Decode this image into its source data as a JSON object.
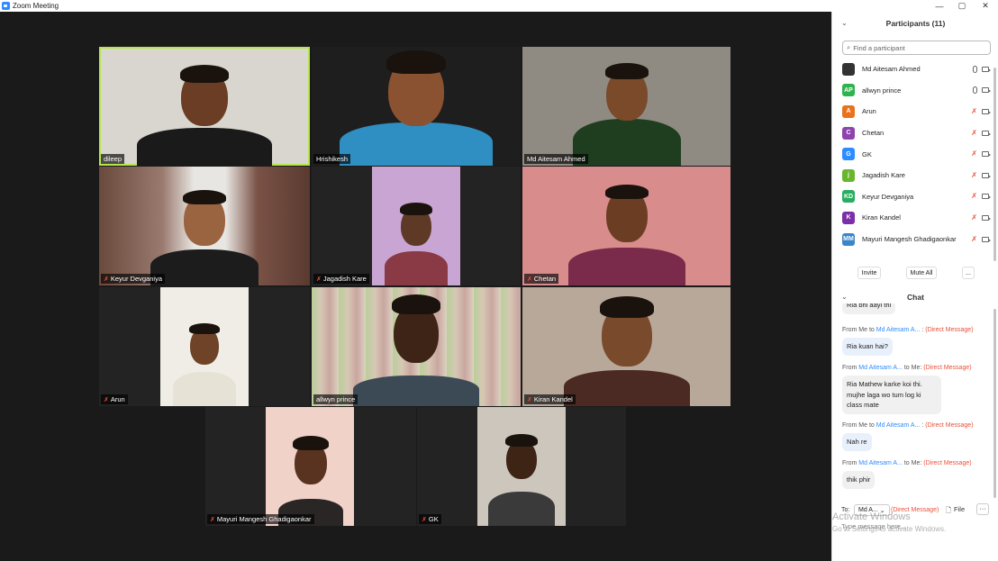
{
  "window": {
    "title": "Zoom Meeting",
    "controls": [
      "—",
      "▢",
      "✕"
    ]
  },
  "tiles": [
    {
      "name": "dileep",
      "muted": false,
      "active": true
    },
    {
      "name": "Hrishikesh",
      "muted": false,
      "active": false
    },
    {
      "name": "Md Aitesam Ahmed",
      "muted": false,
      "active": false
    },
    {
      "name": "Keyur Devganiya",
      "muted": true,
      "active": false
    },
    {
      "name": "Jagadish Kare",
      "muted": true,
      "active": false
    },
    {
      "name": "Chetan",
      "muted": true,
      "active": false
    },
    {
      "name": "Arun",
      "muted": true,
      "active": false
    },
    {
      "name": "allwyn prince",
      "muted": false,
      "active": false
    },
    {
      "name": "Kiran Kandel",
      "muted": true,
      "active": false
    },
    {
      "name": "Mayuri Mangesh Ghadigaonkar",
      "muted": true,
      "active": false
    },
    {
      "name": "GK",
      "muted": true,
      "active": false
    }
  ],
  "participants": {
    "header": "Participants (11)",
    "search_placeholder": "Find a participant",
    "list": [
      {
        "initials": "",
        "name": "Md Aitesam Ahmed",
        "color": "#333333",
        "muted": false
      },
      {
        "initials": "AP",
        "name": "allwyn prince",
        "color": "#2eb34e",
        "muted": false
      },
      {
        "initials": "A",
        "name": "Arun",
        "color": "#e8731c",
        "muted": true
      },
      {
        "initials": "C",
        "name": "Chetan",
        "color": "#8e44ad",
        "muted": true
      },
      {
        "initials": "G",
        "name": "GK",
        "color": "#2d8cff",
        "muted": true
      },
      {
        "initials": "j",
        "name": "Jagadish Kare",
        "color": "#6ab52e",
        "muted": true
      },
      {
        "initials": "KD",
        "name": "Keyur Devganiya",
        "color": "#27ae60",
        "muted": true
      },
      {
        "initials": "K",
        "name": "Kiran Kandel",
        "color": "#7b2fa8",
        "muted": true
      },
      {
        "initials": "MM",
        "name": "Mayuri Mangesh Ghadigaonkar",
        "color": "#3a86c8",
        "muted": true
      }
    ],
    "invite": "Invite",
    "mute_all": "Mute All",
    "more": "..."
  },
  "chat": {
    "header": "Chat",
    "partial_message": "Ria bhi aayi thi",
    "messages": [
      {
        "from": "Me",
        "to": "Md Aitesam A...",
        "tag": "(Direct Message)",
        "text": "Ria kuan hai?",
        "outgoing": true
      },
      {
        "from": "Md Aitesam A...",
        "to": "Me",
        "tag": "(Direct Message)",
        "text": "Ria Mathew karke koi thi. mujhe laga wo tum log ki class mate",
        "outgoing": false
      },
      {
        "from": "Me",
        "to": "Md Aitesam A...",
        "tag": "(Direct Message)",
        "text": "Nah re",
        "outgoing": true
      },
      {
        "from": "Md Aitesam A...",
        "to": "Me",
        "tag": "(Direct Message)",
        "text": "thik phir",
        "outgoing": false
      }
    ],
    "to_label": "To:",
    "to_value": "Md A...",
    "to_tag": "(Direct Message)",
    "file_label": "File",
    "more": "···",
    "input_placeholder": "Type message here..."
  },
  "watermark": {
    "title": "Activate Windows",
    "subtitle": "Go to Settings to activate Windows."
  }
}
